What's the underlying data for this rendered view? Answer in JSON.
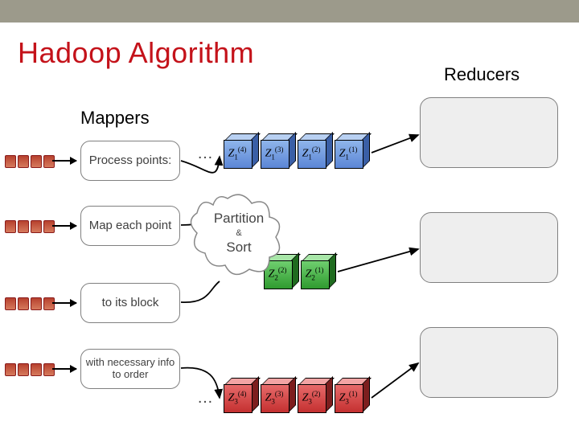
{
  "title": "Hadoop Algorithm",
  "sections": {
    "mappers": "Mappers",
    "reducers": "Reducers"
  },
  "mapboxes": [
    "Process points:",
    "Map each point",
    "to its block",
    "with necessary info to order"
  ],
  "center": {
    "partition": "Partition",
    "amp": "&",
    "sort": "Sort"
  },
  "ellipsis": "…",
  "cubes": {
    "row1": [
      {
        "base": "Z",
        "sub": "1",
        "sup": "(4)"
      },
      {
        "base": "Z",
        "sub": "1",
        "sup": "(3)"
      },
      {
        "base": "Z",
        "sub": "1",
        "sup": "(2)"
      },
      {
        "base": "Z",
        "sub": "1",
        "sup": "(1)"
      }
    ],
    "row2": [
      {
        "base": "Z",
        "sub": "2",
        "sup": "(2)"
      },
      {
        "base": "Z",
        "sub": "2",
        "sup": "(1)"
      }
    ],
    "row3": [
      {
        "base": "Z",
        "sub": "3",
        "sup": "(4)"
      },
      {
        "base": "Z",
        "sub": "3",
        "sup": "(3)"
      },
      {
        "base": "Z",
        "sub": "3",
        "sup": "(2)"
      },
      {
        "base": "Z",
        "sub": "3",
        "sup": "(1)"
      }
    ]
  }
}
